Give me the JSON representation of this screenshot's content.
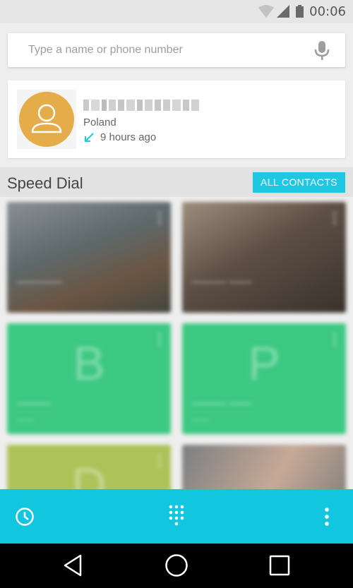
{
  "status_bar": {
    "time": "00:06",
    "icons": [
      "wifi-icon",
      "signal-icon",
      "battery-icon"
    ]
  },
  "search": {
    "placeholder": "Type a name or phone number",
    "icon": "mic-icon"
  },
  "recent_call": {
    "country": "Poland",
    "time_ago": "9 hours ago",
    "avatar_color": "#e5ac4a",
    "call_type_icon": "incoming-call-arrow-icon"
  },
  "speed_dial": {
    "title": "Speed Dial",
    "all_contacts_label": "ALL CONTACTS",
    "accent": "#1ec8e2"
  },
  "tiles": [
    {
      "letter": "",
      "color": "photo"
    },
    {
      "letter": "",
      "color": "photo"
    },
    {
      "letter": "B",
      "color": "#3dc882"
    },
    {
      "letter": "P",
      "color": "#3dc882"
    },
    {
      "letter": "D",
      "color": "#aec25a"
    },
    {
      "letter": "",
      "color": "photo"
    }
  ],
  "bottom_bar": {
    "color": "#12c6df",
    "icons": [
      "clock-history-icon",
      "dialpad-icon",
      "overflow-menu-icon"
    ]
  },
  "nav_bar": {
    "icons": [
      "back-icon",
      "home-icon",
      "recents-icon"
    ]
  }
}
